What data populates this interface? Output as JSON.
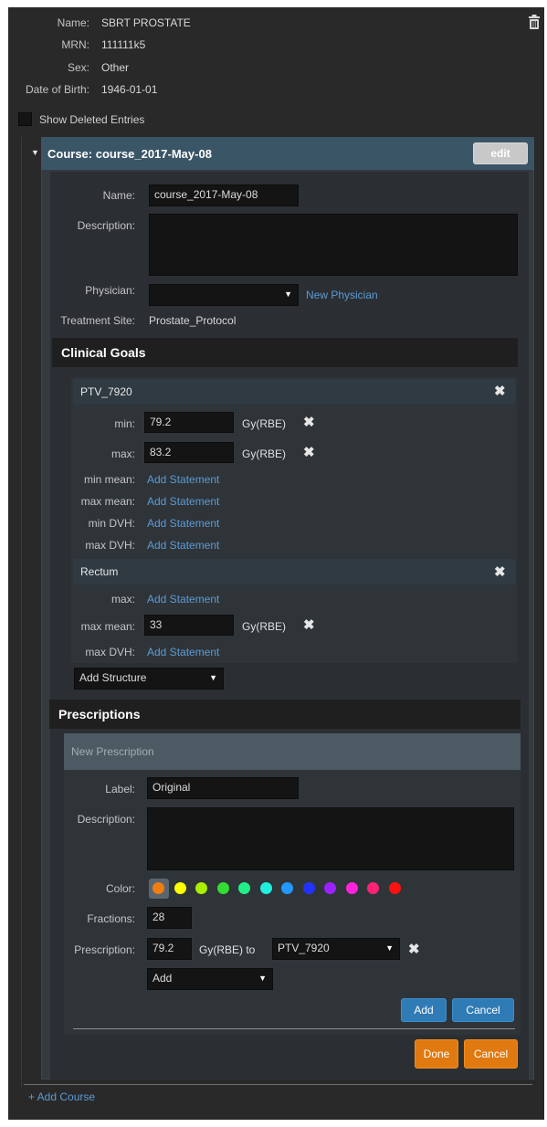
{
  "patient": {
    "name_label": "Name:",
    "name": "SBRT PROSTATE",
    "mrn_label": "MRN:",
    "mrn": "111111k5",
    "sex_label": "Sex:",
    "sex": "Other",
    "dob_label": "Date of Birth:",
    "dob": "1946-01-01"
  },
  "show_deleted_label": "Show Deleted Entries",
  "course": {
    "header": "Course: course_2017-May-08",
    "edit_label": "edit",
    "name_label": "Name:",
    "name_value": "course_2017-May-08",
    "description_label": "Description:",
    "physician_label": "Physician:",
    "physician_value": "",
    "new_physician_link": "New Physician",
    "treatment_site_label": "Treatment Site:",
    "treatment_site": "Prostate_Protocol"
  },
  "clinical_goals": {
    "title": "Clinical Goals",
    "ptv": {
      "name": "PTV_7920",
      "min_label": "min:",
      "min_value": "79.2",
      "max_label": "max:",
      "max_value": "83.2",
      "unit": "Gy(RBE)",
      "min_mean_label": "min mean:",
      "max_mean_label": "max mean:",
      "min_dvh_label": "min DVH:",
      "max_dvh_label": "max DVH:",
      "add_statement": "Add Statement"
    },
    "rectum": {
      "name": "Rectum",
      "max_label": "max:",
      "max_mean_label": "max mean:",
      "max_mean_value": "33",
      "unit": "Gy(RBE)",
      "max_dvh_label": "max DVH:",
      "add_statement": "Add Statement"
    },
    "add_structure": "Add Structure"
  },
  "prescriptions": {
    "title": "Prescriptions",
    "new_header": "New Prescription",
    "label_label": "Label:",
    "label_value": "Original",
    "description_label": "Description:",
    "color_label": "Color:",
    "colors": [
      "#f07d10",
      "#ffff00",
      "#aaee00",
      "#33dd33",
      "#22ee88",
      "#22eedd",
      "#2299ff",
      "#2233ff",
      "#9922ff",
      "#ff22dd",
      "#ff2277",
      "#ff1111"
    ],
    "fractions_label": "Fractions:",
    "fractions_value": "28",
    "prescription_label": "Prescription:",
    "dose_value": "79.2",
    "dose_unit_to": "Gy(RBE) to",
    "target": "PTV_7920",
    "add_select": "Add",
    "add_button": "Add",
    "cancel_button": "Cancel",
    "done_button": "Done",
    "cancel_outer_button": "Cancel"
  },
  "add_course": "+ Add Course"
}
